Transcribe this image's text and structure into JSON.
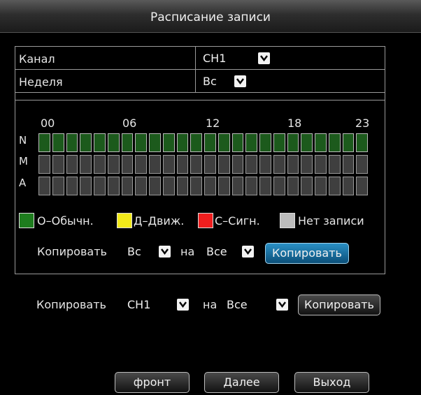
{
  "window": {
    "title": "Расписание записи"
  },
  "channel": {
    "label": "Канал",
    "value": "CH1"
  },
  "week": {
    "label": "Неделя",
    "value": "Вс"
  },
  "schedule": {
    "hour_labels": [
      "00",
      "06",
      "12",
      "18",
      "23"
    ],
    "rows": [
      {
        "label": "N",
        "status": "O-Обычн.",
        "hours": 24,
        "recorded_hours": 24
      },
      {
        "label": "M",
        "status": "Д-Движ.",
        "hours": 24,
        "recorded_hours": 0
      },
      {
        "label": "A",
        "status": "С-Сигн.",
        "hours": 24,
        "recorded_hours": 0
      }
    ]
  },
  "legend": [
    {
      "label": "O–Обычн.",
      "color": "#1e7d1e"
    },
    {
      "label": "Д–Движ.",
      "color": "#f2ea1a"
    },
    {
      "label": "С–Сигн.",
      "color": "#f01e1e"
    },
    {
      "label": "Нет записи",
      "color": "#bdbdbd"
    }
  ],
  "copy_day": {
    "label": "Копировать",
    "from": "Вс",
    "to_label": "на",
    "to": "Все",
    "button": "Копировать"
  },
  "copy_channel": {
    "label": "Копировать",
    "from": "CH1",
    "to_label": "на",
    "to": "Все",
    "button": "Копировать"
  },
  "footer": {
    "front": "фронт",
    "next": "Далее",
    "exit": "Выход"
  }
}
